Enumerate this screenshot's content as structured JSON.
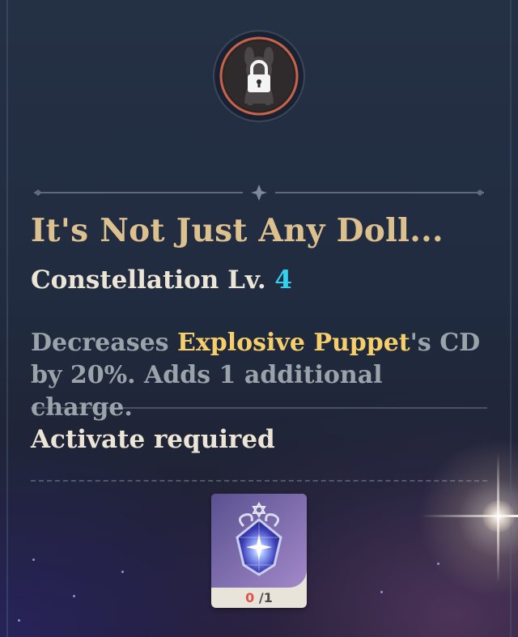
{
  "constellation": {
    "status_icon": "lock-icon",
    "title": "It's Not Just Any Doll...",
    "level_label": "Constellation Lv.",
    "level_value": "4",
    "description": {
      "prefix": "Decreases ",
      "highlight": "Explosive Puppet",
      "suffix": "'s CD by 20%. Adds 1 additional charge."
    },
    "activate_label": "Activate required"
  },
  "material": {
    "icon": "stella-fortuna-icon",
    "have": "0",
    "separator": "/",
    "need": "1"
  },
  "colors": {
    "title": "#dcc08e",
    "level": "#33d2ee",
    "highlight": "#f6cf6a",
    "description": "#9aa2aa",
    "count_have": "#e0524a"
  }
}
